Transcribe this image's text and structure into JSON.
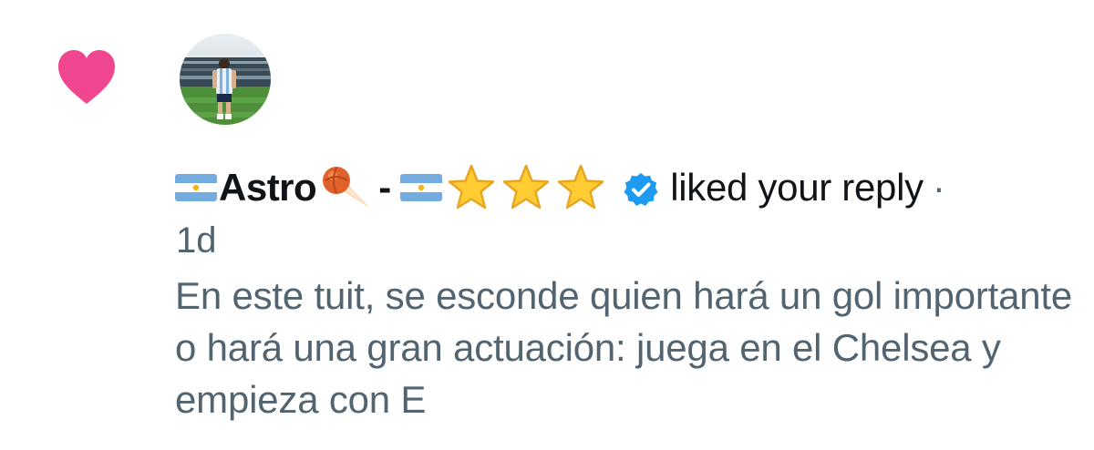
{
  "notification": {
    "type_icon": "heart-icon",
    "avatar_icon": "soccer-player-avatar",
    "display_name": "Astro",
    "name_emojis": [
      "argentina-flag",
      "comet-fireball",
      "argentina-flag",
      "star",
      "star",
      "star"
    ],
    "separator": "-",
    "verified_icon": "verified-badge-icon",
    "action_text": "liked your reply",
    "dot": "·",
    "timestamp": "1d",
    "tweet_text": "En este tuit, se esconde quien hará un gol importante o hará una gran actuación: juega en el Chelsea y empieza con E"
  },
  "colors": {
    "heart": "#f0468f",
    "verified": "#1d9bf0",
    "text_primary": "#0f1419",
    "text_secondary": "#536471",
    "flag_blue": "#74acdf",
    "star": "#ffcc33"
  }
}
